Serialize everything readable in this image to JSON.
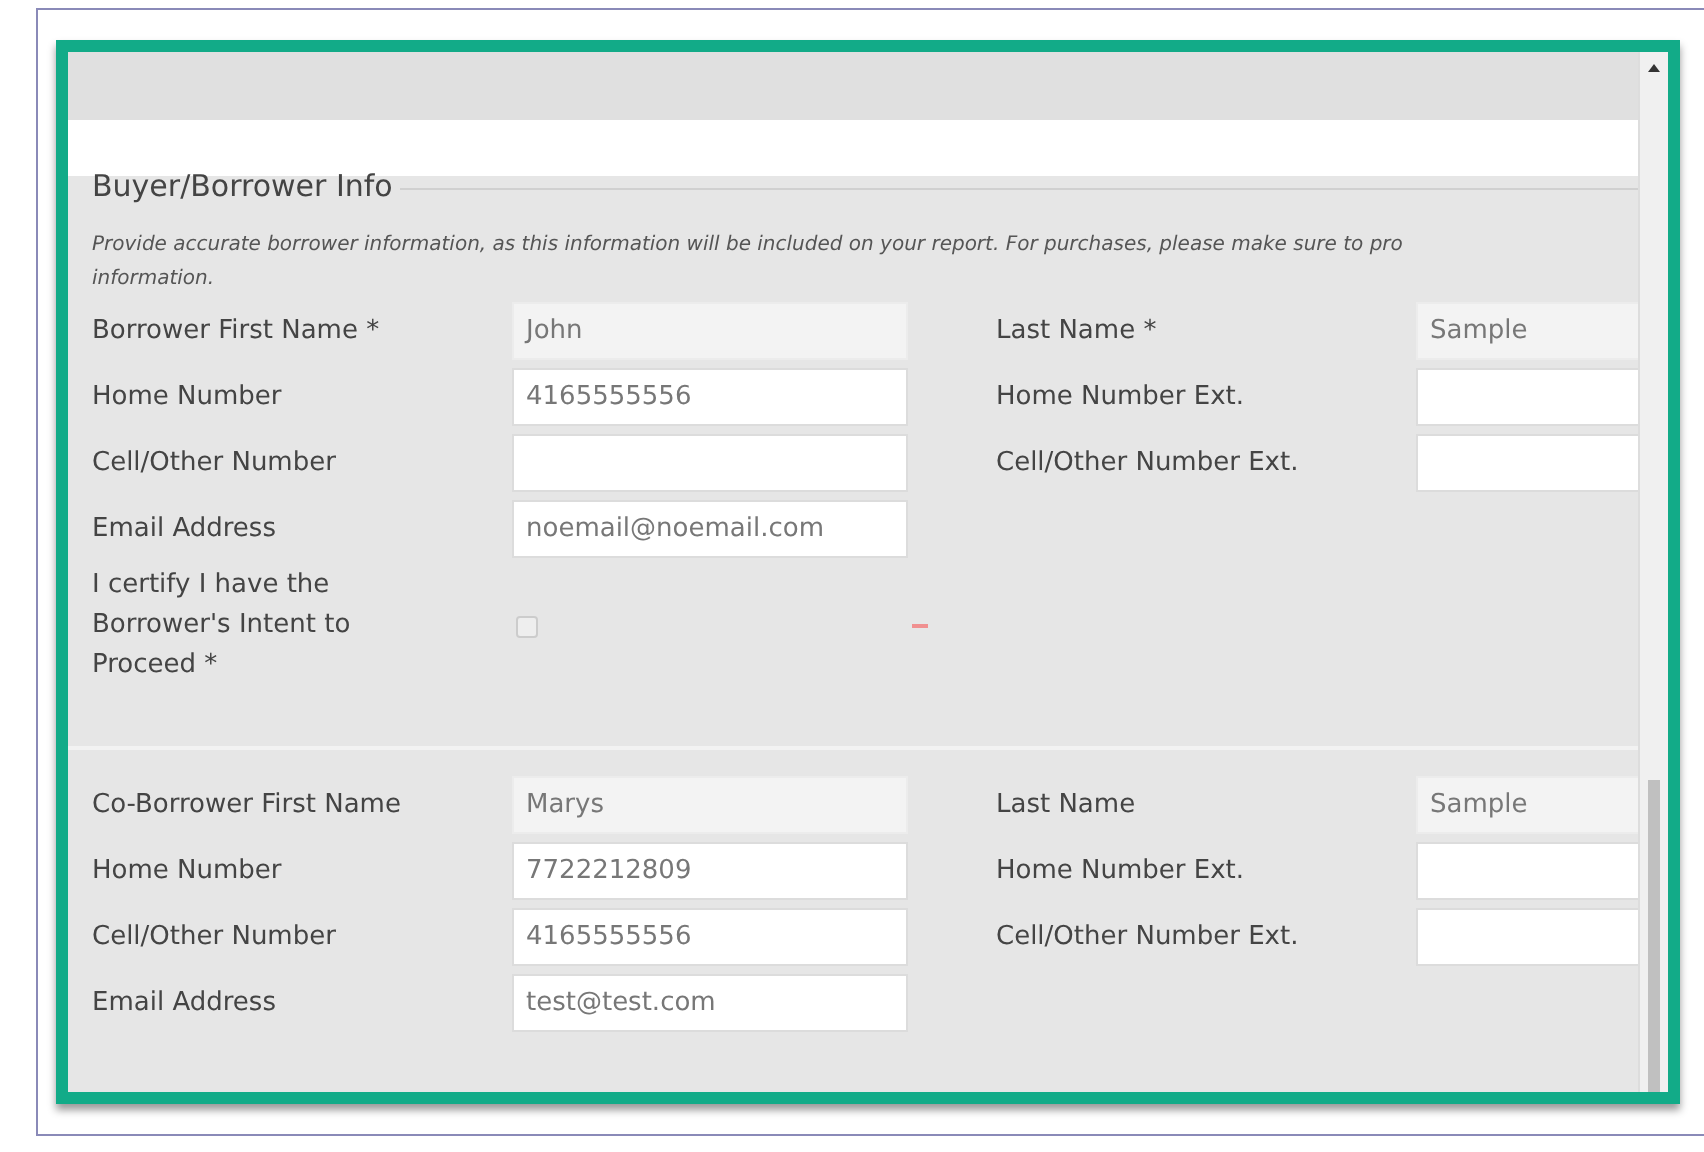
{
  "section_title": "Buyer/Borrower Info",
  "note_lines": [
    "Provide accurate borrower information, as this information will be included on your report. For purchases, please make sure to pro",
    "information."
  ],
  "groups": [
    {
      "rows": [
        {
          "kind": "field",
          "left": {
            "label": "Borrower First Name *",
            "value": "John",
            "readonly": true
          },
          "right": {
            "label": "Last Name *",
            "value": "Sample",
            "readonly": true
          }
        },
        {
          "kind": "field",
          "left": {
            "label": "Home Number",
            "value": "4165555556",
            "readonly": false
          },
          "right": {
            "label": "Home Number Ext.",
            "readonly": false
          }
        },
        {
          "kind": "field",
          "left": {
            "label": "Cell/Other Number",
            "readonly": false
          },
          "right": {
            "label": "Cell/Other Number Ext.",
            "readonly": false
          }
        },
        {
          "kind": "field",
          "left": {
            "label": "Email Address",
            "value": "noemail@noemail.com",
            "readonly": false
          }
        },
        {
          "kind": "checkbox",
          "label": "I certify I have the Borrower's Intent to Proceed *",
          "checked": false
        }
      ]
    },
    {
      "rows": [
        {
          "kind": "field",
          "left": {
            "label": "Co-Borrower First Name",
            "value": "Marys",
            "readonly": true
          },
          "right": {
            "label": "Last Name",
            "value": "Sample",
            "readonly": true
          }
        },
        {
          "kind": "field",
          "left": {
            "label": "Home Number",
            "value": "7722212809",
            "readonly": false
          },
          "right": {
            "label": "Home Number Ext.",
            "readonly": false
          }
        },
        {
          "kind": "field",
          "left": {
            "label": "Cell/Other Number",
            "value": "4165555556",
            "readonly": false
          },
          "right": {
            "label": "Cell/Other Number Ext.",
            "readonly": false
          }
        },
        {
          "kind": "field",
          "left": {
            "label": "Email Address",
            "value": "test@test.com",
            "readonly": false
          }
        }
      ]
    }
  ]
}
